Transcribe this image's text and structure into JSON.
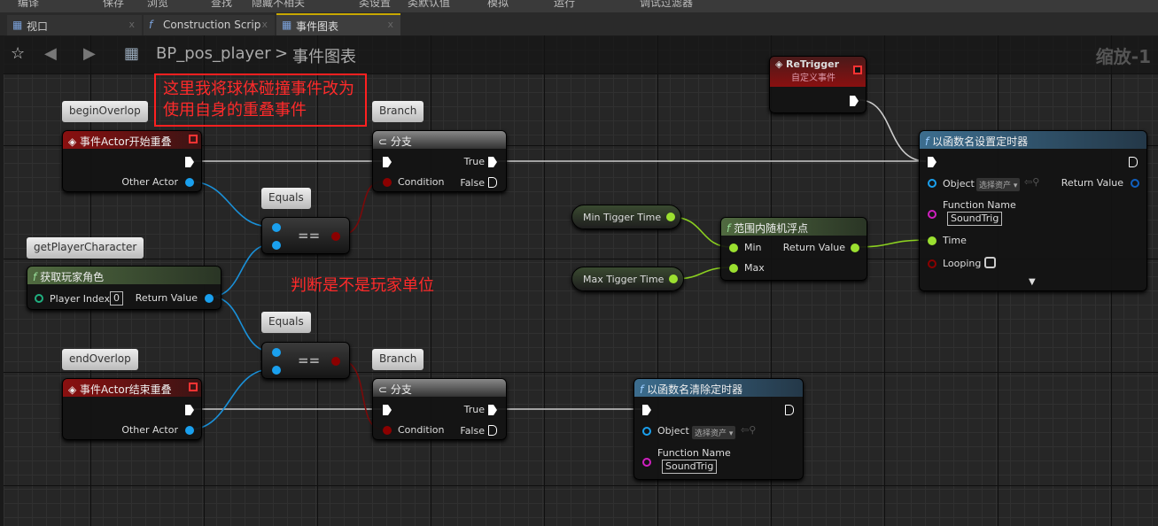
{
  "toolbar": [
    "编译",
    "保存",
    "浏览",
    "查找",
    "隐藏不相关",
    "类设置",
    "类默认值",
    "模拟",
    "运行",
    "调试过滤器"
  ],
  "tabs": [
    {
      "label": "视口",
      "icon": "viewport-icon"
    },
    {
      "label": "Construction Scrip",
      "icon": "function-icon"
    },
    {
      "label": "事件图表",
      "icon": "graph-icon",
      "active": true
    }
  ],
  "breadcrumb": {
    "blueprint": "BP_pos_player",
    "sep": ">",
    "graph": "事件图表"
  },
  "zoom": "缩放-1",
  "comments": {
    "box": [
      "这里我将球体碰撞事件改为",
      "使用自身的重叠事件"
    ],
    "note": "判断是不是玩家单位"
  },
  "nodes": {
    "begin": {
      "bubble": "beginOverlop",
      "title": "事件Actor开始重叠",
      "pin": "Other Actor"
    },
    "end": {
      "bubble": "endOverlop",
      "title": "事件Actor结束重叠",
      "pin": "Other Actor"
    },
    "getpc": {
      "bubble": "getPlayerCharacter",
      "title": "获取玩家角色",
      "index_label": "Player Index",
      "index_value": "0",
      "ret": "Return Value"
    },
    "eq1": {
      "bubble": "Equals",
      "op": "=="
    },
    "eq2": {
      "bubble": "Equals",
      "op": "=="
    },
    "br1": {
      "bubble": "Branch",
      "title": "分支",
      "true": "True",
      "false": "False",
      "cond": "Condition"
    },
    "br2": {
      "bubble": "Branch",
      "title": "分支",
      "true": "True",
      "false": "False",
      "cond": "Condition"
    },
    "retrigger": {
      "title": "ReTrigger",
      "subtitle": "自定义事件"
    },
    "settimer": {
      "title": "以函数名设置定时器",
      "object": "Object",
      "select": "选择资产",
      "ret": "Return Value",
      "fn": "Function Name",
      "fn_value": "SoundTrig",
      "time": "Time",
      "looping": "Looping"
    },
    "random": {
      "title": "范围内随机浮点",
      "min": "Min",
      "max": "Max",
      "ret": "Return Value"
    },
    "minvar": "Min Tigger Time",
    "maxvar": "Max Tigger Time",
    "cleartimer": {
      "title": "以函数名清除定时器",
      "object": "Object",
      "select": "选择资产",
      "fn": "Function Name",
      "fn_value": "SoundTrig"
    }
  },
  "colors": {
    "exec": "#ffffff",
    "object": "#1aa0ee",
    "bool": "#8b0000",
    "float": "#9be030",
    "name": "#d020c0",
    "annotation": "#ff2a2a"
  }
}
